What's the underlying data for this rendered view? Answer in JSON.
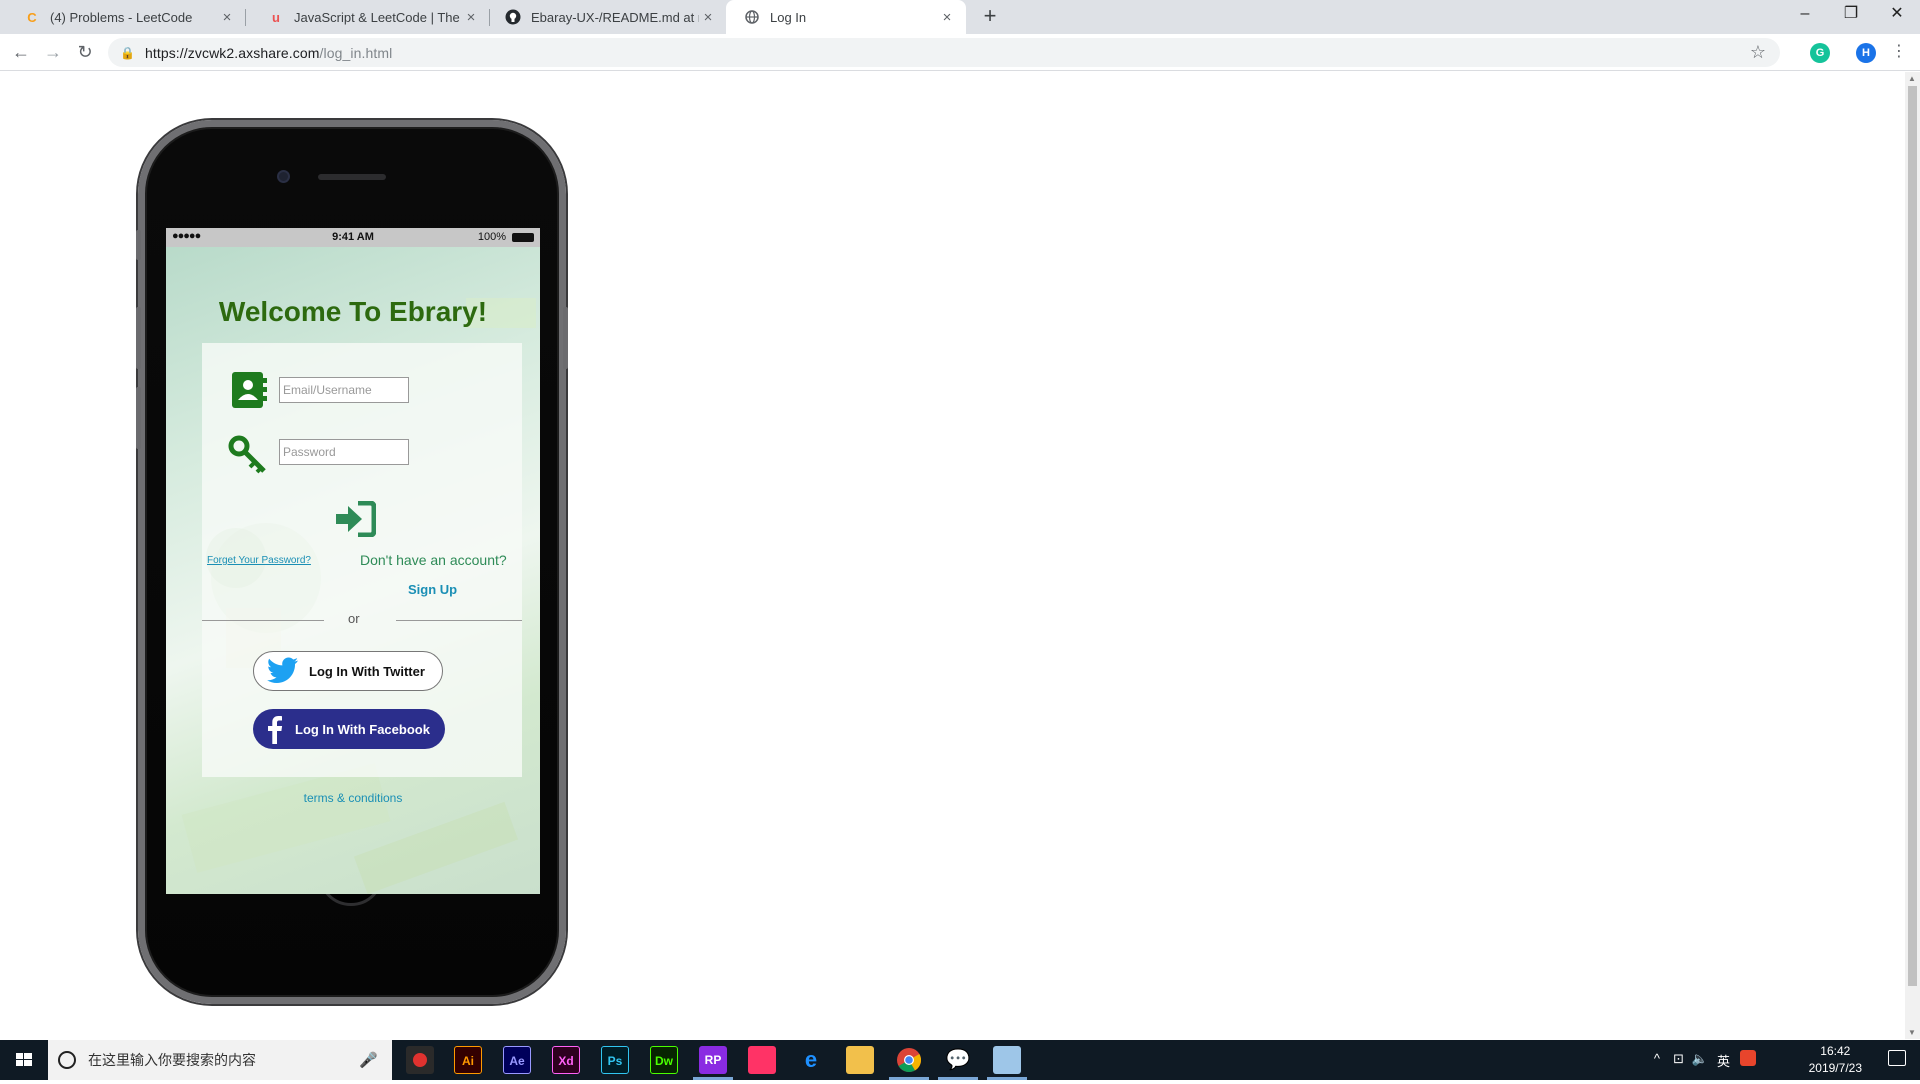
{
  "tabs": [
    {
      "title": "(4) Problems - LeetCode",
      "favicon": "leetcode-icon",
      "active": false
    },
    {
      "title": "JavaScript & LeetCode | The U",
      "favicon": "udemy-icon",
      "active": false
    },
    {
      "title": "Ebaray-UX-/README.md at m",
      "favicon": "github-icon",
      "active": false
    },
    {
      "title": "Log In",
      "favicon": "globe-icon",
      "active": true
    }
  ],
  "address": {
    "domain": "https://zvcwk2.axshare.com",
    "path": "/log_in.html"
  },
  "extensions": {
    "grammarly": "G",
    "profile": "H"
  },
  "phone": {
    "status": {
      "signal": "●●●●●",
      "time": "9:41 AM",
      "battery": "100%"
    },
    "welcome": "Welcome To Ebrary!",
    "email_placeholder": "Email/Username",
    "password_placeholder": "Password",
    "forgot": "Forget Your Password?",
    "no_account": "Don't have an account?",
    "signup": "Sign Up",
    "or": "or",
    "twitter": "Log In With Twitter",
    "facebook": "Log In With Facebook",
    "terms": "terms & conditions",
    "colors": {
      "accent_green": "#2d6a0f",
      "icon_green": "#1e7b1e",
      "link_blue": "#1a8fb5",
      "facebook": "#2b2e8c",
      "twitter": "#1da1f2"
    }
  },
  "taskbar": {
    "search_placeholder": "在这里输入你要搜索的内容",
    "apps": [
      "Ai",
      "Ae",
      "Xd",
      "Ps",
      "Dw",
      "RP"
    ],
    "input_method": "英",
    "time": "16:42",
    "date": "2019/7/23"
  }
}
